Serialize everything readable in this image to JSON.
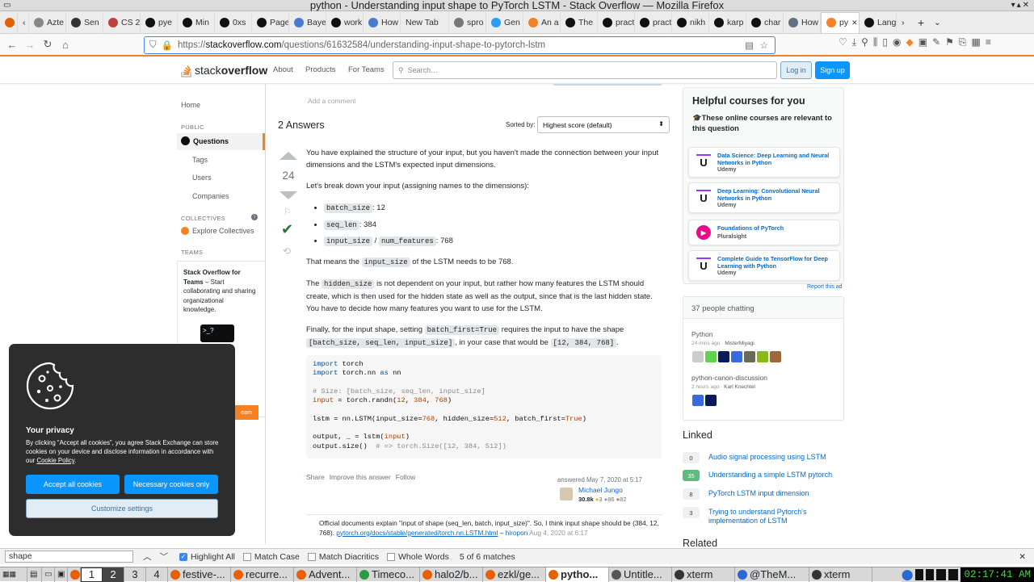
{
  "window": {
    "title": "python - Understanding input shape to PyTorch LSTM - Stack Overflow — Mozilla Firefox"
  },
  "tabs": [
    {
      "label": "Azte",
      "color": "#888"
    },
    {
      "label": "Sen",
      "color": "#333"
    },
    {
      "label": "CS 2",
      "color": "#c04040"
    },
    {
      "label": "pye",
      "color": "#111"
    },
    {
      "label": "Min",
      "color": "#111"
    },
    {
      "label": "0xs",
      "color": "#111"
    },
    {
      "label": "Page",
      "color": "#111"
    },
    {
      "label": "Baye",
      "color": "#4a7bd0"
    },
    {
      "label": "work",
      "color": "#111"
    },
    {
      "label": "How",
      "color": "#4a7bd0"
    },
    {
      "label": "New Tab",
      "color": ""
    },
    {
      "label": "spro",
      "color": "#777"
    },
    {
      "label": "Gen",
      "color": "#2a9df4"
    },
    {
      "label": "An a",
      "color": "#f48225"
    },
    {
      "label": "The",
      "color": "#111"
    },
    {
      "label": "pract",
      "color": "#111"
    },
    {
      "label": "pract",
      "color": "#111"
    },
    {
      "label": "nikh",
      "color": "#111"
    },
    {
      "label": "karp",
      "color": "#111"
    },
    {
      "label": "char",
      "color": "#111"
    },
    {
      "label": "How",
      "color": "#607080"
    },
    {
      "label": "py",
      "color": "#f48225",
      "active": true
    },
    {
      "label": "Lang",
      "color": "#111"
    }
  ],
  "address": {
    "prefix": "https://",
    "domain": "stackoverflow.com",
    "path": "/questions/61632584/understanding-input-shape-to-pytorch-lstm"
  },
  "so_header": {
    "logo_plain": "stack",
    "logo_bold": "overflow",
    "links": [
      "About",
      "Products",
      "For Teams"
    ],
    "search_placeholder": "Search…",
    "login": "Log in",
    "signup": "Sign up"
  },
  "leftnav": {
    "home": "Home",
    "public": "PUBLIC",
    "questions": "Questions",
    "tags": "Tags",
    "users": "Users",
    "companies": "Companies",
    "collectives": "COLLECTIVES",
    "explore": "Explore Collectives",
    "teams": "TEAMS",
    "teams_title": "Stack Overflow for Teams",
    "teams_desc": " – Start collaborating and sharing organizational knowledge.",
    "teams_btn": "eam"
  },
  "answers": {
    "add_comment": "Add a comment",
    "count": "2 Answers",
    "sorted_by": "Sorted by:",
    "sort_value": "Highest score (default)",
    "score": "24",
    "p1": "You have explained the structure of your input, but you haven't made the connection between your input dimensions and the LSTM's expected input dimensions.",
    "p2": "Let's break down your input (assigning names to the dimensions):",
    "b1_code": "batch_size",
    "b1_val": ": 12",
    "b2_code": "seq_len",
    "b2_val": ": 384",
    "b3_code1": "input_size",
    "b3_sep": " / ",
    "b3_code2": "num_features",
    "b3_val": ": 768",
    "p3_a": "That means the ",
    "p3_code": "input_size",
    "p3_b": " of the LSTM needs to be 768.",
    "p4_a": "The ",
    "p4_code": "hidden_size",
    "p4_b": " is not dependent on your input, but rather how many features the LSTM should create, which is then used for the hidden state as well as the output, since that is the last hidden state. You have to decide how many features you want to use for the LSTM.",
    "p5_a": "Finally, for the input shape, setting ",
    "p5_code1": "batch_first=True",
    "p5_b": " requires the input to have the shape ",
    "p5_code2": "[batch_size, seq_len, input_size]",
    "p5_c": ", in your case that would be ",
    "p5_code3": "[12, 384, 768]",
    "p5_d": ".",
    "actions": [
      "Share",
      "Improve this answer",
      "Follow"
    ],
    "answered": "answered May 7, 2020 at 5:17",
    "user": "Michael Jungo",
    "rep": "30.8k",
    "gold": "3",
    "silver": "86",
    "bronze": "82",
    "comment": "Official documents explain \"input of shape (seq_len, batch, input_size)\". So, I think input shape should be (384, 12, 768).",
    "comment_link": "pytorch.org/docs/stable/generated/torch.nn.LSTM.html",
    "comment_dash": " – ",
    "comment_user": "hiropon",
    "comment_date": "Aug 4, 2020 at 6:17"
  },
  "code_lines": [
    [
      {
        "t": "import",
        "c": "kw"
      },
      {
        "t": " torch"
      }
    ],
    [
      {
        "t": "import",
        "c": "kw"
      },
      {
        "t": " torch.nn "
      },
      {
        "t": "as",
        "c": "kw"
      },
      {
        "t": " nn"
      }
    ],
    [
      {
        "t": ""
      }
    ],
    [
      {
        "t": "# Size: [batch_size, seq_len, input_size]",
        "c": "cm"
      }
    ],
    [
      {
        "t": "input",
        "c": "num"
      },
      {
        "t": " = torch.randn("
      },
      {
        "t": "12",
        "c": "num"
      },
      {
        "t": ", "
      },
      {
        "t": "384",
        "c": "num"
      },
      {
        "t": ", "
      },
      {
        "t": "768",
        "c": "num"
      },
      {
        "t": ")"
      }
    ],
    [
      {
        "t": ""
      }
    ],
    [
      {
        "t": "lstm = nn.LSTM(input_size="
      },
      {
        "t": "768",
        "c": "num"
      },
      {
        "t": ", hidden_size="
      },
      {
        "t": "512",
        "c": "num"
      },
      {
        "t": ", batch_first="
      },
      {
        "t": "True",
        "c": "num"
      },
      {
        "t": ")"
      }
    ],
    [
      {
        "t": ""
      }
    ],
    [
      {
        "t": "output, _ = lstm("
      },
      {
        "t": "input",
        "c": "num"
      },
      {
        "t": ")"
      }
    ],
    [
      {
        "t": "output.size()  "
      },
      {
        "t": "# => torch.Size([12, 384, 512])",
        "c": "cm"
      }
    ]
  ],
  "sidebar": {
    "courses_title": "Helpful courses for you",
    "courses_sub": "🎓These online courses are relevant to this question",
    "courses": [
      {
        "title": "Data Science: Deep Learning and Neural Networks in Python",
        "provider": "Udemy",
        "icon": "U"
      },
      {
        "title": "Deep Learning: Convolutional Neural Networks in Python",
        "provider": "Udemy",
        "icon": "U"
      },
      {
        "title": "Foundations of PyTorch",
        "provider": "Pluralsight",
        "icon": "▶"
      },
      {
        "title": "Complete Guide to TensorFlow for Deep Learning with Python",
        "provider": "Udemy",
        "icon": "U"
      }
    ],
    "report_ad": "Report this ad",
    "chat_header": "37 people chatting",
    "room1": "Python",
    "room1_meta_time": "24 mins ago",
    "room1_meta_user": "MisterMiyagi",
    "room2": "python-canon-discussion",
    "room2_meta_time": "2 hours ago",
    "room2_meta_user": "Karl Knechtel",
    "linked_title": "Linked",
    "linked": [
      {
        "score": "0",
        "title": "Audio signal processing using LSTM"
      },
      {
        "score": "35",
        "title": "Understanding a simple LSTM pytorch"
      },
      {
        "score": "8",
        "title": "PyTorch LSTM input dimension"
      },
      {
        "score": "3",
        "title": "Trying to understand Pytorch's implementation of LSTM"
      }
    ],
    "related_title": "Related"
  },
  "cookie": {
    "title": "Your privacy",
    "body_a": "By clicking “Accept all cookies”, you agree Stack Exchange can store cookies on your device and disclose information in accordance with our ",
    "body_link": "Cookie Policy",
    "body_b": ".",
    "accept": "Accept all cookies",
    "necessary": "Necessary cookies only",
    "customize": "Customize settings"
  },
  "findbar": {
    "query": "shape",
    "highlight": "Highlight All",
    "match_case": "Match Case",
    "diacritics": "Match Diacritics",
    "whole": "Whole Words",
    "result": "5 of 6 matches"
  },
  "taskbar": {
    "workspaces": [
      "1",
      "2",
      "3",
      "4"
    ],
    "windows": [
      "festive-...",
      "recurre...",
      "Advent...",
      "Timeco...",
      "halo2/b...",
      "ezkl/ge...",
      "pytho...",
      "Untitle...",
      "xterm",
      "@TheM...",
      "xterm"
    ],
    "clock": "02:17:41 AM"
  },
  "colors": {
    "accent": "#f48225",
    "button_blue": "#0a95ff",
    "accepted_green": "#2f6f44",
    "link": "#0a68c4"
  }
}
